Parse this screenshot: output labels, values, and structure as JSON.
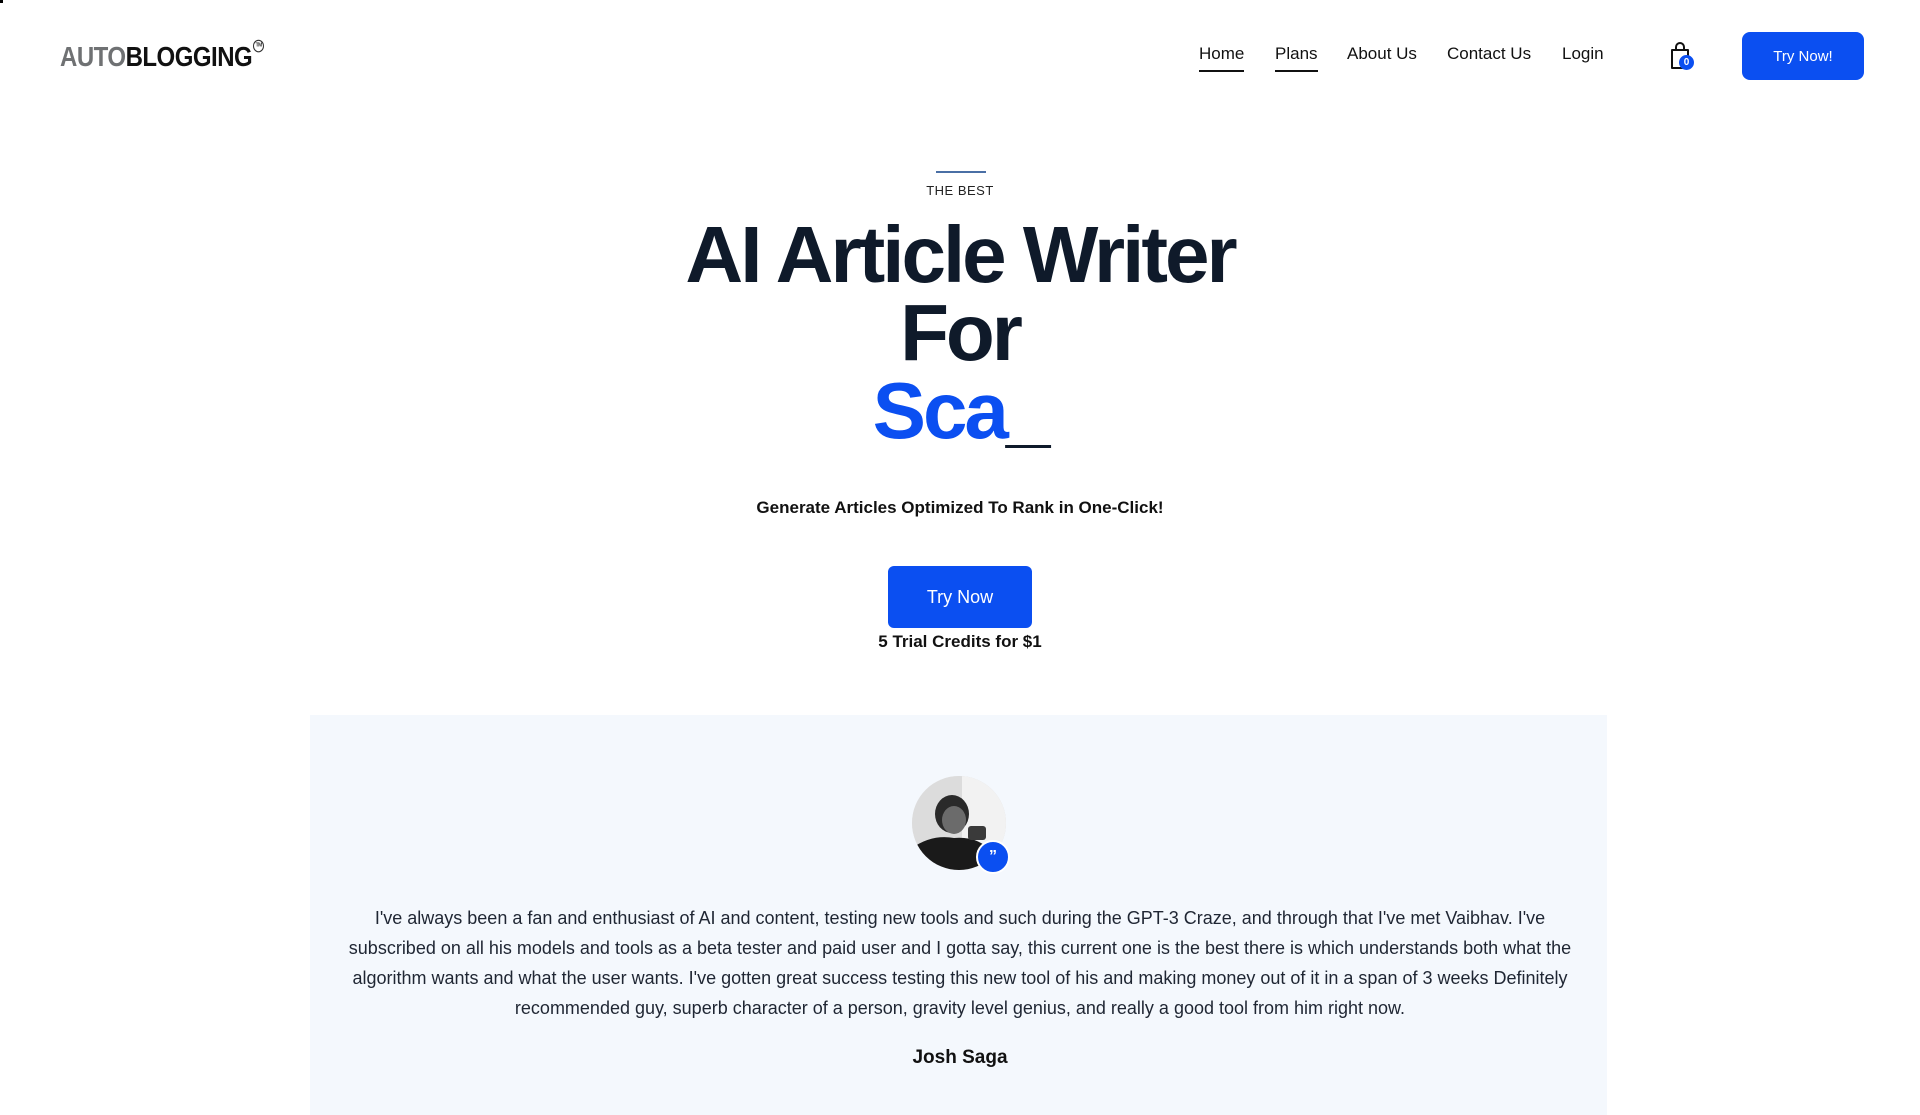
{
  "brand": {
    "logo_part1": "AUTO",
    "logo_part2": "BLOGGING",
    "logo_mark": "TM"
  },
  "nav": {
    "items": [
      {
        "label": "Home",
        "active": true
      },
      {
        "label": "Plans",
        "active": true
      },
      {
        "label": "About Us",
        "active": false
      },
      {
        "label": "Contact Us",
        "active": false
      },
      {
        "label": "Login",
        "active": false
      }
    ],
    "cart_count": "0",
    "cart_icon": "shopping-bag-icon",
    "cta_label": "Try Now!"
  },
  "hero": {
    "eyebrow": "THE BEST",
    "headline_line1": "AI Article Writer",
    "headline_line2": "For",
    "typed_word": "Sca",
    "typed_cursor": "_",
    "subhead": "Generate Articles Optimized To Rank in One-Click!",
    "cta_label": "Try Now",
    "trial_note": "5 Trial Credits for $1"
  },
  "testimonial": {
    "quote_icon": "quote-icon",
    "text": "I've always been a fan and enthusiast of AI and content, testing new tools and such during the GPT-3 Craze, and through that I've met Vaibhav. I've subscribed on all his models and tools as a beta tester and paid user and I gotta say, this current one is the best there is which understands both what the algorithm wants and what the user wants. I've gotten great success testing this new tool of his and making money out of it in a span of 3 weeks Definitely recommended guy, superb character of a person, gravity level genius, and really a good tool from him right now.",
    "author": "Josh Saga"
  },
  "colors": {
    "accent": "#0b4ff1",
    "heading": "#0f1a2a",
    "testimonial_bg": "#f4f8fd"
  }
}
